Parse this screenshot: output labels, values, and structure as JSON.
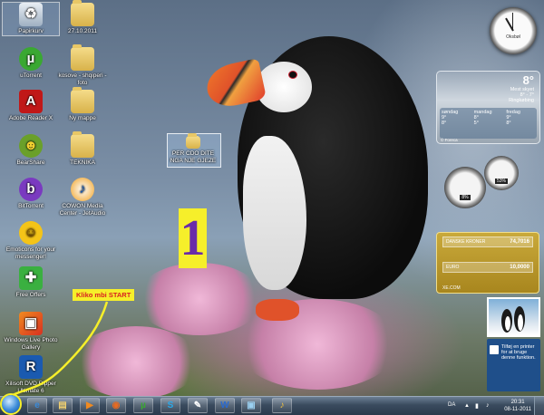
{
  "desktop": {
    "icons": [
      {
        "label": "Papirkurv",
        "icon": "recycle-bin-icon"
      },
      {
        "label": "27.10.2011",
        "icon": "folder-icon"
      },
      {
        "label": "uTorrent",
        "icon": "utorrent-icon"
      },
      {
        "label": "kosove - shqiperi - foto",
        "icon": "folder-shortcut-icon"
      },
      {
        "label": "Adobe Reader X",
        "icon": "adobe-reader-icon"
      },
      {
        "label": "Ny mappe",
        "icon": "folder-icon"
      },
      {
        "label": "BearShare",
        "icon": "bearshare-icon"
      },
      {
        "label": "TEKNIKA",
        "icon": "folder-shortcut-icon"
      },
      {
        "label": "BitTorrent",
        "icon": "bittorrent-icon"
      },
      {
        "label": "COWON Media Center - JetAudio",
        "icon": "jetaudio-icon"
      },
      {
        "label": "Emoticons for your messenger!",
        "icon": "emoticon-icon"
      },
      {
        "label": "Free Offers",
        "icon": "gift-icon"
      },
      {
        "label": "Windows Live Photo Gallery",
        "icon": "photo-gallery-icon"
      },
      {
        "label": "Xilisoft DVD Ripper Ultimate 6",
        "icon": "xilisoft-icon"
      }
    ],
    "selected_folder_label": "PER CDO DITE NGA NJE GJEZE",
    "number_marker": "1",
    "callout": {
      "prefix": "Kliko mbi ",
      "highlight": "START"
    },
    "colors": {
      "annotation_yellow": "#f6ef2a",
      "callout_red": "#d82020",
      "number_purple": "#6a2ca8"
    }
  },
  "gadgets": {
    "clock": {
      "city": "Oksbøl"
    },
    "weather": {
      "temp": "8°",
      "condition": "Mest skyet",
      "range": "8° - 7°",
      "location": "Ringkøbing",
      "days": [
        {
          "name": "søndag",
          "hi": "9°",
          "lo": "8°"
        },
        {
          "name": "mandag",
          "hi": "8°",
          "lo": "5°"
        },
        {
          "name": "fredag",
          "hi": "9°",
          "lo": "8°"
        }
      ],
      "credit": "© Foreca"
    },
    "meters": {
      "cpu": "8%",
      "ram": "53%"
    },
    "currency": {
      "title": "DANSKE KRONER",
      "rows": [
        {
          "label": "DANSKE KRONER",
          "value": "74,7016"
        },
        {
          "label": "EURO",
          "value": "10,0000"
        }
      ],
      "source": "XE.COM"
    },
    "tip": {
      "text": "Tilføj en printer for at bruge denne funktion."
    }
  },
  "taskbar": {
    "buttons": [
      {
        "name": "internet-explorer",
        "glyph": "e"
      },
      {
        "name": "windows-explorer",
        "glyph": "▤"
      },
      {
        "name": "media-player",
        "glyph": "▶"
      },
      {
        "name": "firefox",
        "glyph": "◉"
      },
      {
        "name": "utorrent",
        "glyph": "µ"
      },
      {
        "name": "skype",
        "glyph": "S"
      },
      {
        "name": "notepad",
        "glyph": "✎"
      },
      {
        "name": "word",
        "glyph": "W"
      },
      {
        "name": "photo-viewer",
        "glyph": "▣"
      },
      {
        "name": "jetaudio",
        "glyph": "♪"
      }
    ],
    "language": "DA",
    "time": "20:31",
    "date": "08-11-2011"
  }
}
